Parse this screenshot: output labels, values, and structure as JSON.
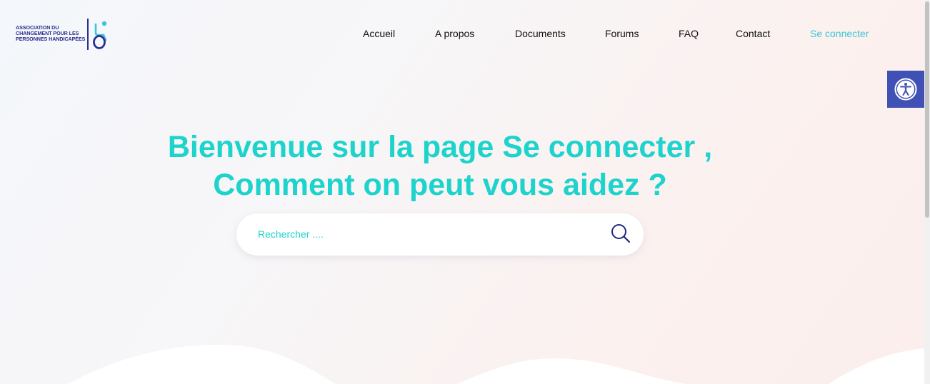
{
  "logo": {
    "lines": [
      "ASSOCIATION DU",
      "CHANGEMENT POUR LES",
      "PERSONNES HANDICAPÉES"
    ],
    "icon": "wheelchair-logo-icon"
  },
  "nav": {
    "items": [
      {
        "label": "Accueil"
      },
      {
        "label": "A propos"
      },
      {
        "label": "Documents"
      },
      {
        "label": "Forums"
      },
      {
        "label": "FAQ"
      },
      {
        "label": "Contact"
      },
      {
        "label": "Se connecter",
        "active": true
      }
    ]
  },
  "accessibility": {
    "icon": "accessibility-icon",
    "color": "#3f51b5"
  },
  "hero": {
    "line1": "Bienvenue sur la page Se connecter ,",
    "line2": "Comment on peut vous aidez ?",
    "color": "#1ed3cc"
  },
  "search": {
    "placeholder": "Rechercher ....",
    "value": "",
    "icon": "search-icon",
    "icon_color": "#1f2a7a"
  },
  "colors": {
    "accent": "#1ed3cc",
    "nav_active": "#3cc4d9",
    "brand": "#2c2f8f"
  }
}
